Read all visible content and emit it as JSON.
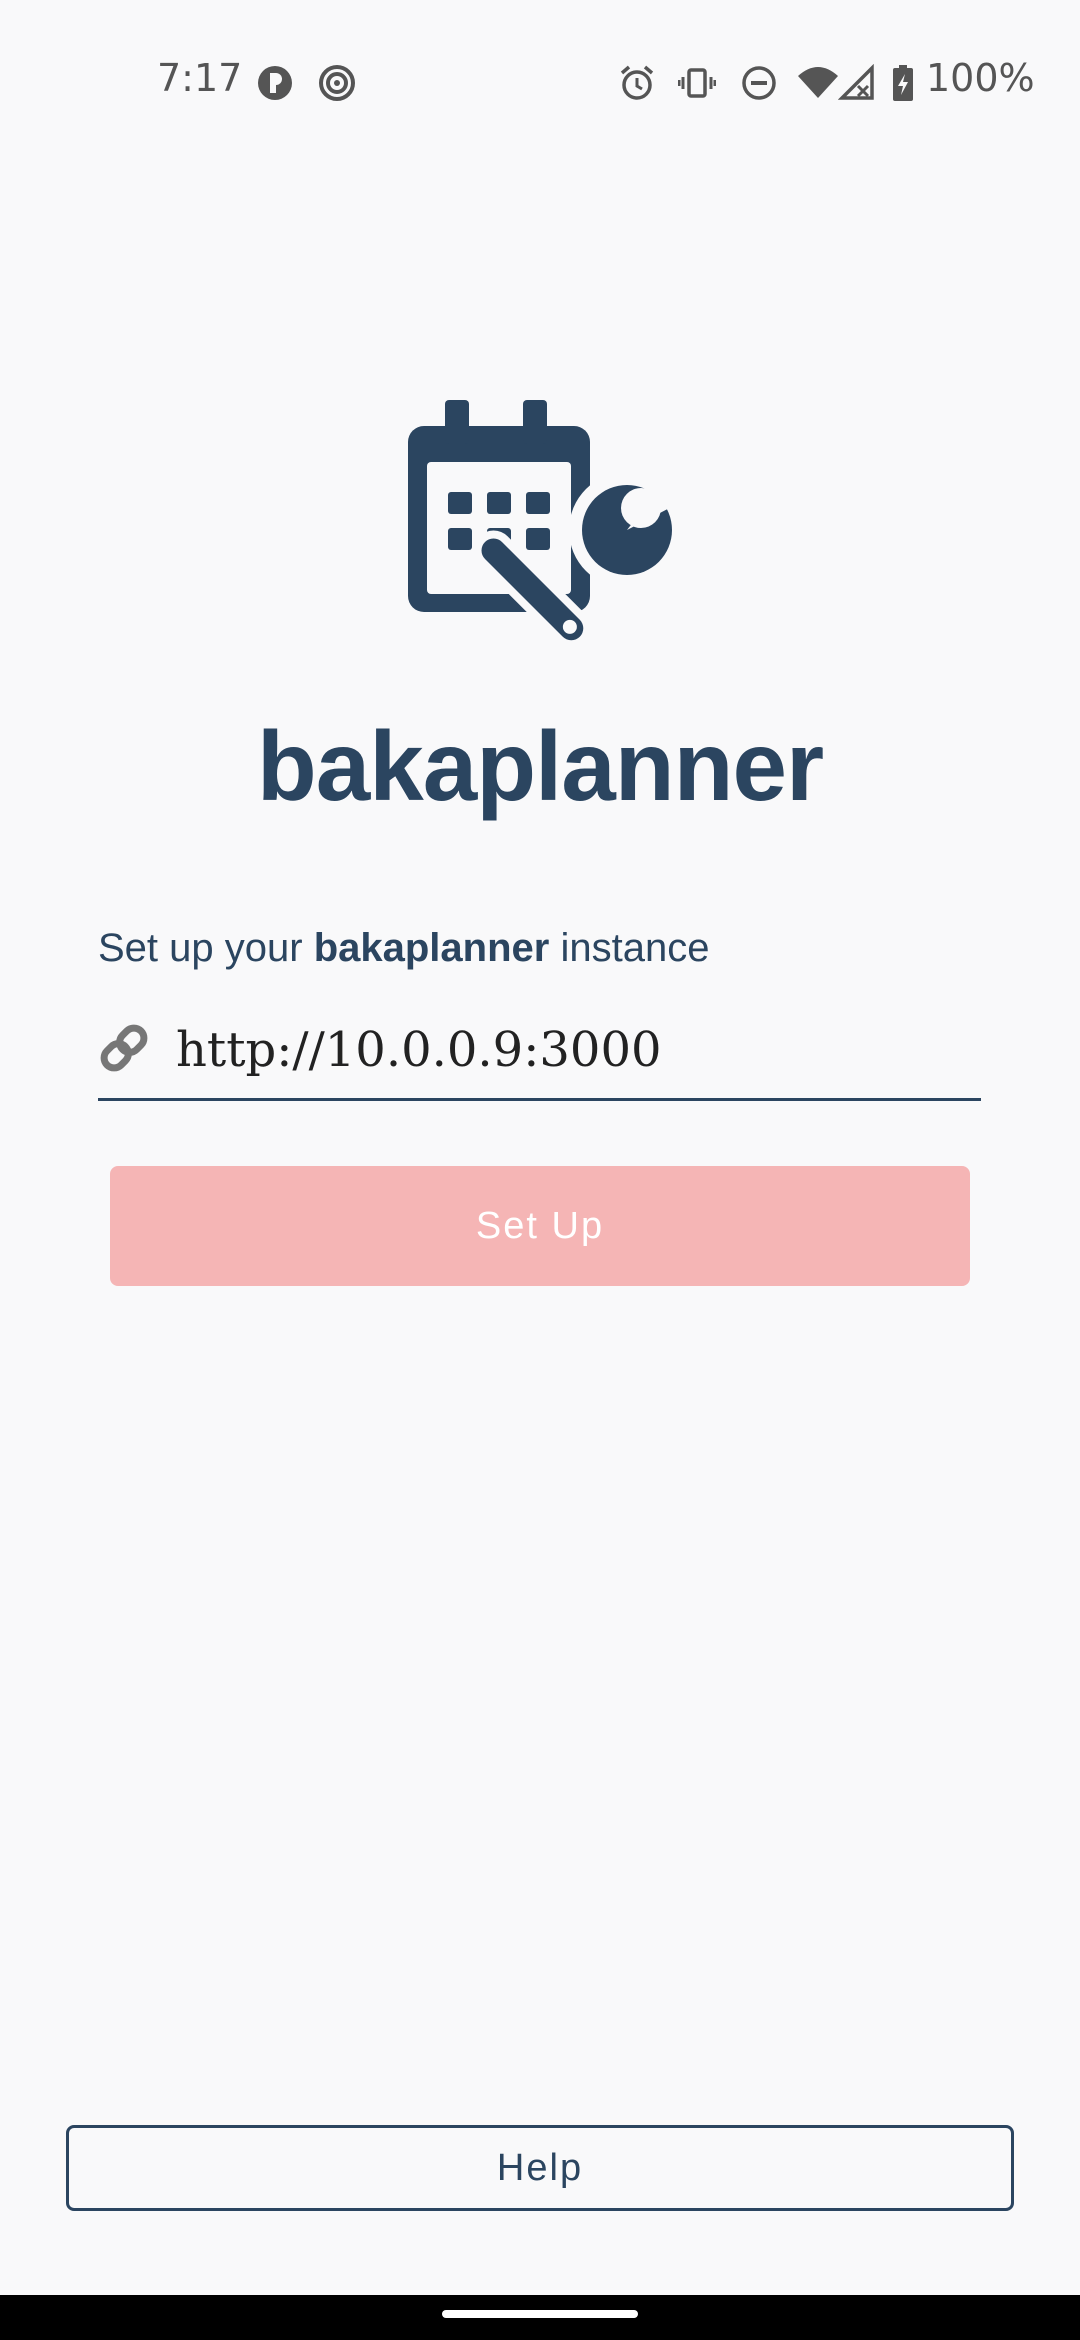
{
  "status_bar": {
    "time": "7:17",
    "battery": "100%",
    "icons": [
      "app-notification-icon",
      "radar-icon",
      "alarm-icon",
      "vibrate-icon",
      "do-not-disturb-icon",
      "wifi-icon",
      "no-signal-icon",
      "battery-charging-icon"
    ]
  },
  "app": {
    "name": "bakaplanner",
    "logo_icon": "calendar-wrench-icon"
  },
  "setup": {
    "instruction_prefix": "Set up your ",
    "instruction_bold": "bakaplanner",
    "instruction_suffix": " instance",
    "url_value": "http://10.0.0.9:3000",
    "setup_label": "Set Up",
    "help_label": "Help"
  },
  "colors": {
    "primary": "#2b4560",
    "setup_button_disabled": "#f5b5b5",
    "background": "#f9f9fa"
  }
}
